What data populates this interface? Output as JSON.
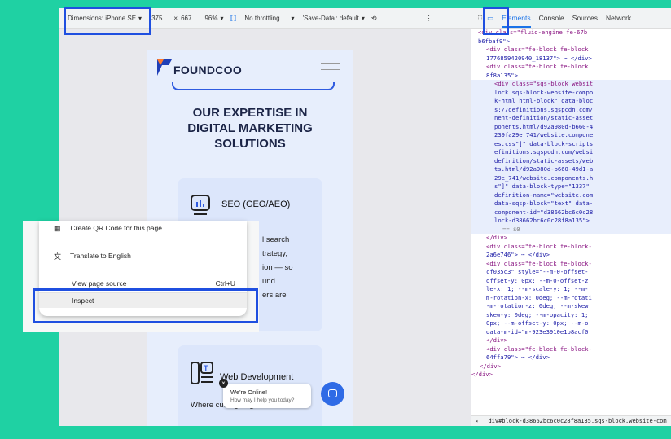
{
  "toolbar": {
    "dimensions_label": "Dimensions: iPhone SE",
    "width": "375",
    "times": "×",
    "height": "667",
    "zoom": "96%",
    "throttling": "No throttling",
    "save_data": "'Save-Data': default"
  },
  "devtools_tabs": [
    "Elements",
    "Console",
    "Sources",
    "Network"
  ],
  "site": {
    "logo_text": "FOUNDCOO",
    "headline_line1": "OUR EXPERTISE IN",
    "headline_line2": "DIGITAL MARKETING",
    "headline_line3": "SOLUTIONS",
    "card1_title": "SEO (GEO/AEO)",
    "card1_text_lines": [
      "l search",
      "trategy,",
      "ion — so",
      "und",
      "ers are"
    ],
    "card2_title": "Web Development",
    "card2_text": "Where cutting-edge",
    "chat_title": "We're Online!",
    "chat_subtitle": "How may I help you today?"
  },
  "context_menu": {
    "item1": "Create QR Code for this page",
    "item2": "Translate to English",
    "item3": "View page source",
    "item3_shortcut": "Ctrl+U",
    "item4": "Inspect"
  },
  "elements": {
    "lines": [
      "<div class=\"fluid-engine fe-67b",
      "b6fbaf9\">",
      "<div class=\"fe-block fe-block",
      "1776859420940_18137\"> ⋯ </div>",
      "<div class=\"fe-block fe-block",
      "8f8a135\">",
      "<div class=\"sqs-block websit",
      "lock sqs-block-website-compo",
      "k-html html-block\" data-bloc",
      "s://definitions.sqspcdn.com/",
      "nent-definition/static-asset",
      "ponents.html/d92a980d-b660-4",
      "239fa29e_741/website.compone",
      "es.css\"]\" data-block-scripts",
      "efinitions.sqspcdn.com/websi",
      "definition/static-assets/web",
      "ts.html/d92a980d-b660-49d1-a",
      "29e_741/website.components.h",
      "s\"]\" data-block-type=\"1337\"",
      "definition-name=\"website.com",
      "data-sqsp-block=\"text\" data-",
      "component-id=\"d38662bc6c0c28",
      "lock-d38662bc6c0c28f8a135\">",
      "== $0",
      "</div>",
      "<div class=\"fe-block fe-block-",
      "2a6e746\"> ⋯ </div>",
      "<div class=\"fe-block fe-block-",
      "cf035c3\" style=\"--m-0-offset-",
      "offset-y: 0px; --m-0-offset-z",
      "le-x: 1; --m-scale-y: 1; --m-",
      "m-rotation-x: 0deg; --m-rotati",
      "-m-rotation-z: 0deg; --m-skew",
      "skew-y: 0deg; --m-opacity: 1;",
      "0px; --m-offset-y: 0px; --m-o",
      "data-m-id=\"m-923e3910e1b8acf0",
      "</div>",
      "<div class=\"fe-block fe-block-",
      "64ffa79\"> ⋯ </div>",
      "</div>",
      "</div>"
    ],
    "status": "div#block-d38662bc6c0c28f8a135.sqs-block.website-com"
  }
}
